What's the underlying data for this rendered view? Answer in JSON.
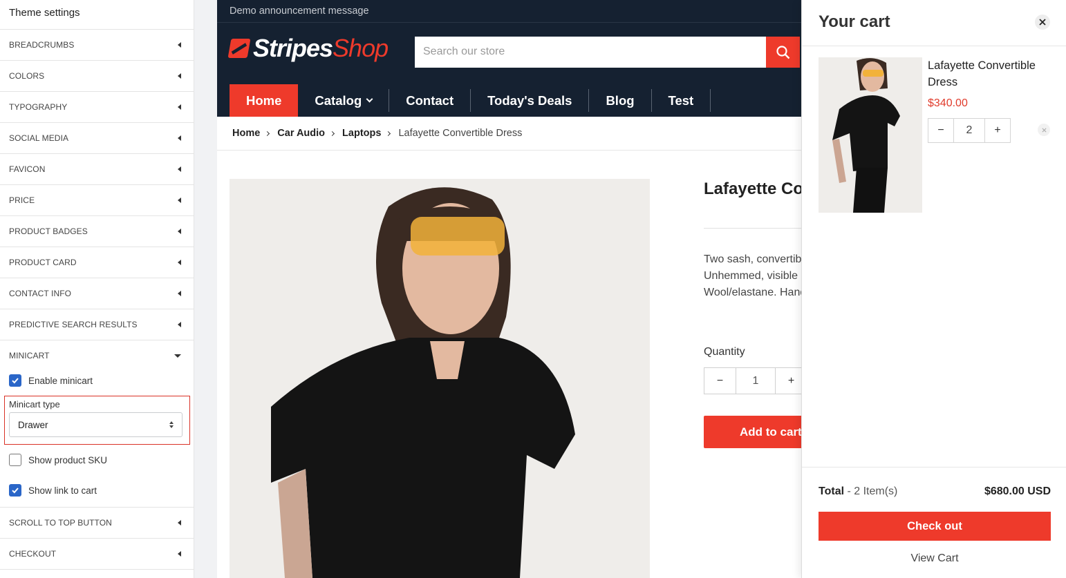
{
  "settings": {
    "title": "Theme settings",
    "sections_top": [
      "BREADCRUMBS",
      "COLORS",
      "TYPOGRAPHY",
      "SOCIAL MEDIA",
      "FAVICON",
      "PRICE",
      "PRODUCT BADGES",
      "PRODUCT CARD",
      "CONTACT INFO",
      "PREDICTIVE SEARCH RESULTS"
    ],
    "minicart": {
      "label": "MINICART",
      "enable_label": "Enable minicart",
      "enable_checked": true,
      "type_label": "Minicart type",
      "type_value": "Drawer",
      "sku_label": "Show product SKU",
      "sku_checked": false,
      "link_label": "Show link to cart",
      "link_checked": true
    },
    "sections_bottom": [
      "SCROLL TO TOP BUTTON",
      "CHECKOUT"
    ]
  },
  "store": {
    "announcement": "Demo announcement message",
    "logo_part1": "Stripes",
    "logo_part2": "Shop",
    "search_placeholder": "Search our store",
    "nav": [
      "Home",
      "Catalog",
      "Contact",
      "Today's Deals",
      "Blog",
      "Test"
    ],
    "breadcrumbs": [
      "Home",
      "Car Audio",
      "Laptops"
    ],
    "breadcrumb_current": "Lafayette Convertible Dress",
    "product": {
      "title": "Lafayette Convertible Dress",
      "desc_lines": [
        "Two sash, convertible neckline",
        "Unhemmed, visible seams",
        "Wool/elastane. Hand wash"
      ],
      "quantity_label": "Quantity",
      "quantity": "1",
      "add_to_cart": "Add to cart"
    }
  },
  "cart": {
    "title": "Your cart",
    "item_name": "Lafayette Convertible Dress",
    "item_price": "$340.00",
    "item_qty": "2",
    "total_label": "Total",
    "total_count": "- 2 Item(s)",
    "total_amount": "$680.00 USD",
    "checkout": "Check out",
    "view_cart": "View Cart"
  },
  "colors": {
    "accent": "#ee3a2b",
    "header_bg": "#152131",
    "checkbox_blue": "#2a66c8"
  }
}
